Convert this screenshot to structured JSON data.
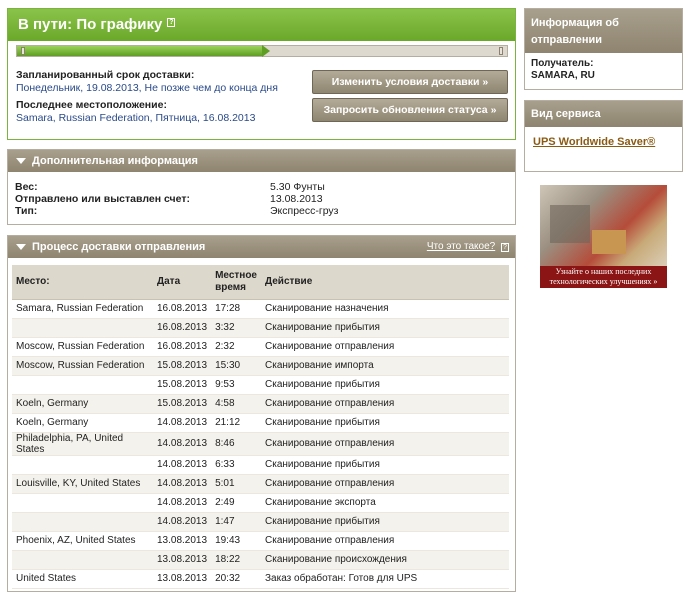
{
  "status": {
    "title": "В пути: По графику",
    "help_glyph": "?",
    "progress_fraction": 0.5,
    "scheduled_label": "Запланированный срок доставки:",
    "scheduled_value": "Понедельник, 19.08.2013, Не позже чем до конца дня",
    "location_label": "Последнее местоположение:",
    "location_value": "Samara, Russian Federation, Пятница, 16.08.2013",
    "btn_change": "Изменить условия доставки »",
    "btn_request": "Запросить обновления статуса »"
  },
  "additional": {
    "title": "Дополнительная информация",
    "rows": [
      {
        "label": "Вес:",
        "value": "5.30 Фунты"
      },
      {
        "label": "Отправлено или выставлен счет:",
        "value": "13.08.2013"
      },
      {
        "label": "Тип:",
        "value": "Экспресс-груз"
      }
    ]
  },
  "progress_section": {
    "title": "Процесс доставки отправления",
    "whats_this": "Что это такое?",
    "headers": {
      "place": "Место:",
      "date": "Дата",
      "time": "Местное время",
      "action": "Действие"
    },
    "rows": [
      {
        "place": "Samara, Russian Federation",
        "date": "16.08.2013",
        "time": "17:28",
        "action": "Сканирование назначения"
      },
      {
        "place": "",
        "date": "16.08.2013",
        "time": "3:32",
        "action": "Сканирование прибытия"
      },
      {
        "place": "Moscow, Russian Federation",
        "date": "16.08.2013",
        "time": "2:32",
        "action": "Сканирование отправления"
      },
      {
        "place": "Moscow, Russian Federation",
        "date": "15.08.2013",
        "time": "15:30",
        "action": "Сканирование импорта"
      },
      {
        "place": "",
        "date": "15.08.2013",
        "time": "9:53",
        "action": "Сканирование прибытия"
      },
      {
        "place": "Koeln, Germany",
        "date": "15.08.2013",
        "time": "4:58",
        "action": "Сканирование отправления"
      },
      {
        "place": "Koeln, Germany",
        "date": "14.08.2013",
        "time": "21:12",
        "action": "Сканирование прибытия"
      },
      {
        "place": "Philadelphia, PA, United States",
        "date": "14.08.2013",
        "time": "8:46",
        "action": "Сканирование отправления"
      },
      {
        "place": "",
        "date": "14.08.2013",
        "time": "6:33",
        "action": "Сканирование прибытия"
      },
      {
        "place": "Louisville, KY, United States",
        "date": "14.08.2013",
        "time": "5:01",
        "action": "Сканирование отправления"
      },
      {
        "place": "",
        "date": "14.08.2013",
        "time": "2:49",
        "action": "Сканирование экспорта"
      },
      {
        "place": "",
        "date": "14.08.2013",
        "time": "1:47",
        "action": "Сканирование прибытия"
      },
      {
        "place": "Phoenix, AZ, United States",
        "date": "13.08.2013",
        "time": "19:43",
        "action": "Сканирование отправления"
      },
      {
        "place": "",
        "date": "13.08.2013",
        "time": "18:22",
        "action": "Сканирование происхождения"
      },
      {
        "place": "United States",
        "date": "13.08.2013",
        "time": "20:32",
        "action": "Заказ обработан: Готов для UPS"
      }
    ]
  },
  "sidebar": {
    "shipment_title": "Информация об отправлении",
    "recipient_label": "Получатель:",
    "recipient_value": "SAMARA, RU",
    "service_title": "Вид сервиса",
    "service_link": "UPS Worldwide Saver®",
    "promo_caption": "Узнайте о наших последних технологических улучшениях »"
  }
}
